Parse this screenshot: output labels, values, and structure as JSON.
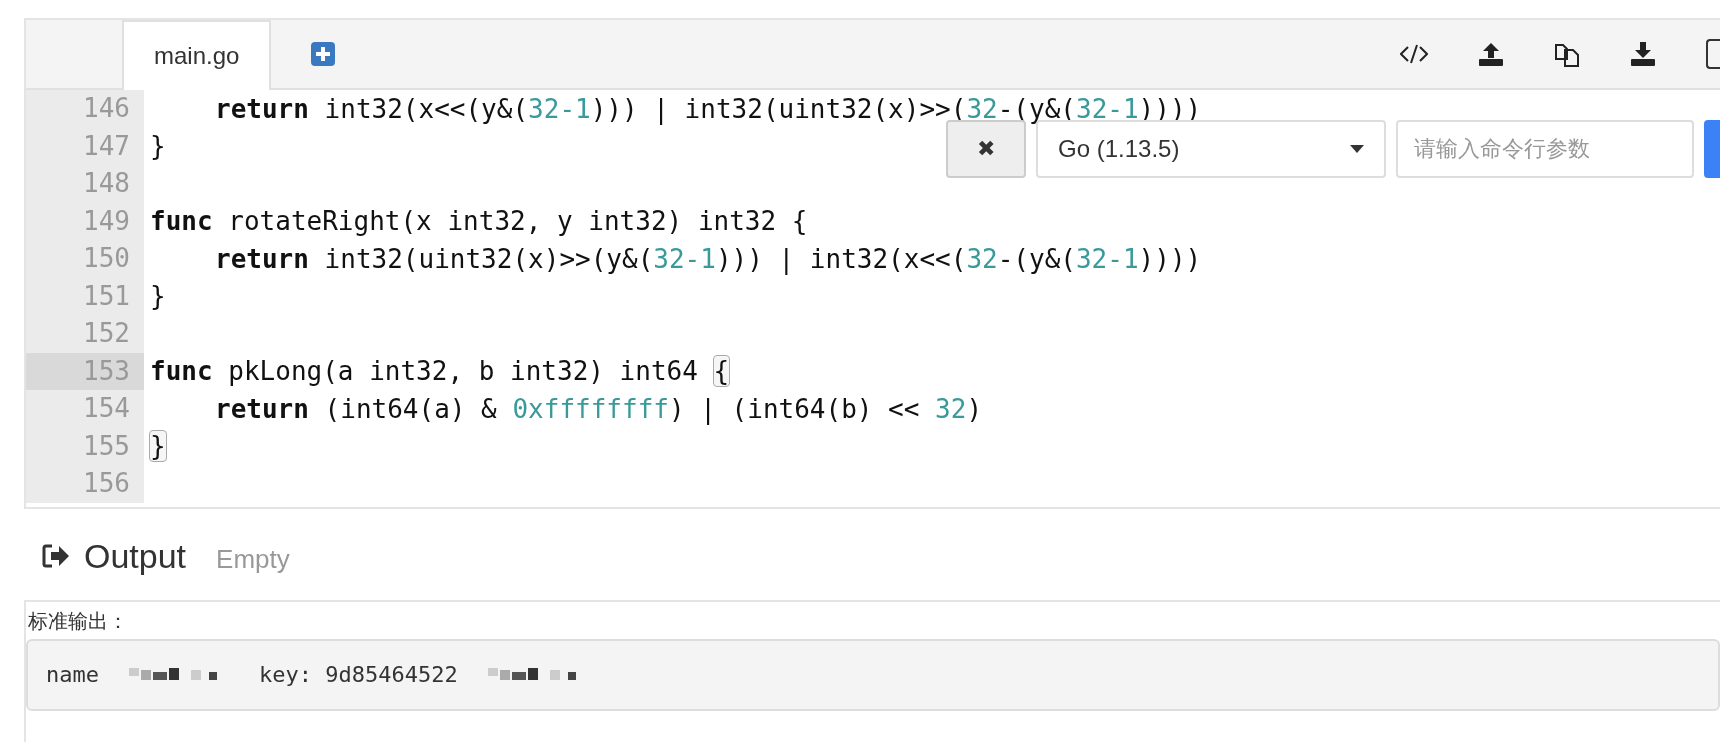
{
  "tabs": [
    {
      "label": "main.go",
      "selected": true
    }
  ],
  "code_lines": [
    {
      "number": "146",
      "active": false,
      "indented": true,
      "tokens": [
        {
          "kind": "keyword",
          "text": "return"
        },
        {
          "kind": "plain",
          "text": " int32(x<<(y&("
        },
        {
          "kind": "number",
          "text": "32-1"
        },
        {
          "kind": "plain",
          "text": "))) | int32(uint32(x)>>("
        },
        {
          "kind": "number",
          "text": "32"
        },
        {
          "kind": "plain",
          "text": "-(y&("
        },
        {
          "kind": "number",
          "text": "32-1"
        },
        {
          "kind": "plain",
          "text": "))))"
        }
      ]
    },
    {
      "number": "147",
      "active": false,
      "indented": false,
      "tokens": [
        {
          "kind": "plain",
          "text": "}"
        }
      ]
    },
    {
      "number": "148",
      "active": false
    },
    {
      "number": "149",
      "active": false,
      "indented": false,
      "tokens": [
        {
          "kind": "keyword",
          "text": "func"
        },
        {
          "kind": "plain",
          "text": " rotateRight(x int32, y int32) int32 {"
        }
      ]
    },
    {
      "number": "150",
      "active": false,
      "indented": true,
      "tokens": [
        {
          "kind": "keyword",
          "text": "return"
        },
        {
          "kind": "plain",
          "text": " int32(uint32(x)>>(y&("
        },
        {
          "kind": "number",
          "text": "32-1"
        },
        {
          "kind": "plain",
          "text": "))) | int32(x<<("
        },
        {
          "kind": "number",
          "text": "32"
        },
        {
          "kind": "plain",
          "text": "-(y&("
        },
        {
          "kind": "number",
          "text": "32-1"
        },
        {
          "kind": "plain",
          "text": "))))"
        }
      ]
    },
    {
      "number": "151",
      "active": false,
      "indented": false,
      "tokens": [
        {
          "kind": "plain",
          "text": "}"
        }
      ]
    },
    {
      "number": "152",
      "active": false
    },
    {
      "number": "153",
      "active": true,
      "indented": false,
      "tokens": [
        {
          "kind": "keyword",
          "text": "func"
        },
        {
          "kind": "plain",
          "text": " pkLong(a int32, b int32) int64 "
        },
        {
          "kind": "matched",
          "text": "{"
        }
      ]
    },
    {
      "number": "154",
      "active": false,
      "indented": true,
      "tokens": [
        {
          "kind": "keyword",
          "text": "return"
        },
        {
          "kind": "plain",
          "text": " (int64(a) & "
        },
        {
          "kind": "number",
          "text": "0xffffffff"
        },
        {
          "kind": "plain",
          "text": ") | (int64(b) << "
        },
        {
          "kind": "number",
          "text": "32"
        },
        {
          "kind": "plain",
          "text": ")"
        }
      ]
    },
    {
      "number": "155",
      "active": false,
      "indented": false,
      "tokens": [
        {
          "kind": "matched",
          "text": "}"
        }
      ]
    },
    {
      "number": "156",
      "active": false
    }
  ],
  "run_bar": {
    "close": "✖",
    "language": "Go (1.13.5)",
    "args_placeholder": "请输入命令行参数"
  },
  "output": {
    "title": "Output",
    "status": "Empty",
    "stdout_label": "标准输出：",
    "stdout": [
      {
        "kind": "text",
        "text": "name"
      },
      {
        "kind": "redacted"
      },
      {
        "kind": "text",
        "text": "key: 9d85464522"
      },
      {
        "kind": "redacted"
      }
    ]
  }
}
